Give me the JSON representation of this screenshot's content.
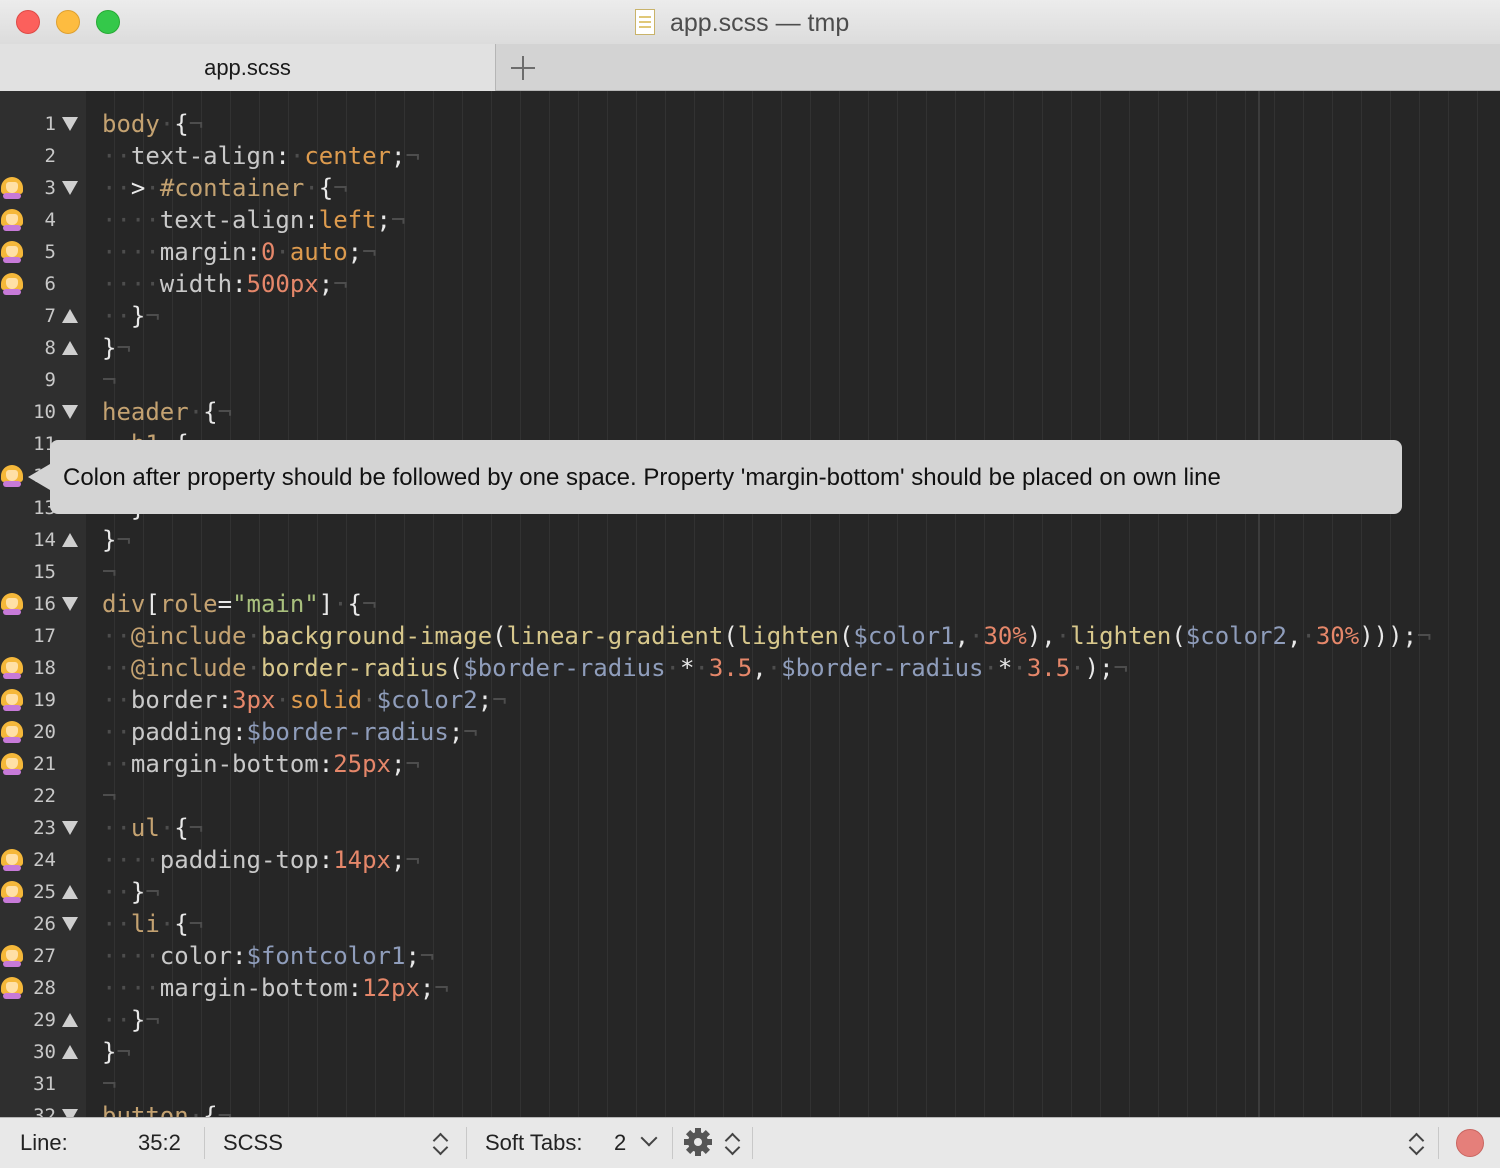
{
  "window": {
    "title": "app.scss — tmp",
    "file_icon": "document-icon"
  },
  "tabs": [
    {
      "label": "app.scss",
      "active": true
    }
  ],
  "new_tab_icon": "plus-icon",
  "editor": {
    "lines": [
      {
        "n": "1",
        "fold": "down",
        "mark": false,
        "tokens": [
          [
            "sel",
            "body"
          ],
          [
            "ws",
            "·"
          ],
          [
            "punc",
            "{"
          ],
          [
            "ws",
            "¬"
          ]
        ]
      },
      {
        "n": "2",
        "fold": "",
        "mark": false,
        "tokens": [
          [
            "ws",
            "··"
          ],
          [
            "prop",
            "text-align"
          ],
          [
            "punc",
            ":"
          ],
          [
            "ws",
            "·"
          ],
          [
            "val",
            "center"
          ],
          [
            "punc",
            ";"
          ],
          [
            "ws",
            "¬"
          ]
        ]
      },
      {
        "n": "3",
        "fold": "down",
        "mark": true,
        "tokens": [
          [
            "ws",
            "··"
          ],
          [
            "punc",
            ">"
          ],
          [
            "ws",
            "·"
          ],
          [
            "sel",
            "#container"
          ],
          [
            "ws",
            "·"
          ],
          [
            "punc",
            "{"
          ],
          [
            "ws",
            "¬"
          ]
        ]
      },
      {
        "n": "4",
        "fold": "",
        "mark": true,
        "tokens": [
          [
            "ws",
            "····"
          ],
          [
            "prop",
            "text-align"
          ],
          [
            "punc",
            ":"
          ],
          [
            "val",
            "left"
          ],
          [
            "punc",
            ";"
          ],
          [
            "ws",
            "¬"
          ]
        ]
      },
      {
        "n": "5",
        "fold": "",
        "mark": true,
        "tokens": [
          [
            "ws",
            "····"
          ],
          [
            "prop",
            "margin"
          ],
          [
            "punc",
            ":"
          ],
          [
            "num",
            "0"
          ],
          [
            "ws",
            "·"
          ],
          [
            "val",
            "auto"
          ],
          [
            "punc",
            ";"
          ],
          [
            "ws",
            "¬"
          ]
        ]
      },
      {
        "n": "6",
        "fold": "",
        "mark": true,
        "tokens": [
          [
            "ws",
            "····"
          ],
          [
            "prop",
            "width"
          ],
          [
            "punc",
            ":"
          ],
          [
            "num",
            "500px"
          ],
          [
            "punc",
            ";"
          ],
          [
            "ws",
            "¬"
          ]
        ]
      },
      {
        "n": "7",
        "fold": "up",
        "mark": false,
        "tokens": [
          [
            "ws",
            "··"
          ],
          [
            "punc",
            "}"
          ],
          [
            "ws",
            "¬"
          ]
        ]
      },
      {
        "n": "8",
        "fold": "up",
        "mark": false,
        "tokens": [
          [
            "punc",
            "}"
          ],
          [
            "ws",
            "¬"
          ]
        ]
      },
      {
        "n": "9",
        "fold": "",
        "mark": false,
        "tokens": [
          [
            "ws",
            "¬"
          ]
        ]
      },
      {
        "n": "10",
        "fold": "down",
        "mark": false,
        "tokens": [
          [
            "sel",
            "header"
          ],
          [
            "ws",
            "·"
          ],
          [
            "punc",
            "{"
          ],
          [
            "ws",
            "¬"
          ]
        ]
      },
      {
        "n": "11",
        "fold": "",
        "mark": false,
        "tokens": [
          [
            "ws",
            "··"
          ],
          [
            "sel",
            "h1"
          ],
          [
            "ws",
            "·"
          ],
          [
            "punc",
            "{"
          ],
          [
            "ws",
            "¬"
          ]
        ]
      },
      {
        "n": "12",
        "fold": "",
        "mark": false,
        "tokens": []
      },
      {
        "n": "13",
        "fold": "",
        "mark": false,
        "tokens": [
          [
            "ws",
            "··"
          ],
          [
            "punc",
            "}"
          ],
          [
            "ws",
            "¬"
          ]
        ]
      },
      {
        "n": "14",
        "fold": "up",
        "mark": false,
        "tokens": [
          [
            "punc",
            "}"
          ],
          [
            "ws",
            "¬"
          ]
        ]
      },
      {
        "n": "15",
        "fold": "",
        "mark": false,
        "tokens": [
          [
            "ws",
            "¬"
          ]
        ]
      },
      {
        "n": "16",
        "fold": "down",
        "mark": true,
        "tokens": [
          [
            "sel",
            "div"
          ],
          [
            "punc",
            "["
          ],
          [
            "sel",
            "role"
          ],
          [
            "punc",
            "="
          ],
          [
            "str",
            "\"main\""
          ],
          [
            "punc",
            "]"
          ],
          [
            "ws",
            "·"
          ],
          [
            "punc",
            "{"
          ],
          [
            "ws",
            "¬"
          ]
        ]
      },
      {
        "n": "17",
        "fold": "",
        "mark": false,
        "tokens": [
          [
            "ws",
            "··"
          ],
          [
            "at",
            "@include"
          ],
          [
            "ws",
            "·"
          ],
          [
            "func",
            "background-image"
          ],
          [
            "punc",
            "("
          ],
          [
            "func",
            "linear-gradient"
          ],
          [
            "punc",
            "("
          ],
          [
            "func",
            "lighten"
          ],
          [
            "punc",
            "("
          ],
          [
            "var",
            "$color1"
          ],
          [
            "punc",
            ","
          ],
          [
            "ws",
            "·"
          ],
          [
            "num",
            "30%"
          ],
          [
            "punc",
            "),"
          ],
          [
            "ws",
            "·"
          ],
          [
            "func",
            "lighten"
          ],
          [
            "punc",
            "("
          ],
          [
            "var",
            "$color2"
          ],
          [
            "punc",
            ","
          ],
          [
            "ws",
            "·"
          ],
          [
            "num",
            "30%"
          ],
          [
            "punc",
            ")));"
          ],
          [
            "ws",
            "¬"
          ]
        ]
      },
      {
        "n": "18",
        "fold": "",
        "mark": true,
        "tokens": [
          [
            "ws",
            "··"
          ],
          [
            "at",
            "@include"
          ],
          [
            "ws",
            "·"
          ],
          [
            "func",
            "border-radius"
          ],
          [
            "punc",
            "("
          ],
          [
            "var",
            "$border-radius"
          ],
          [
            "ws",
            "·"
          ],
          [
            "punc",
            "*"
          ],
          [
            "ws",
            "·"
          ],
          [
            "num",
            "3.5"
          ],
          [
            "punc",
            ","
          ],
          [
            "ws",
            "·"
          ],
          [
            "var",
            "$border-radius"
          ],
          [
            "ws",
            "·"
          ],
          [
            "punc",
            "*"
          ],
          [
            "ws",
            "·"
          ],
          [
            "num",
            "3.5"
          ],
          [
            "ws",
            "·"
          ],
          [
            "punc",
            ");"
          ],
          [
            "ws",
            "¬"
          ]
        ]
      },
      {
        "n": "19",
        "fold": "",
        "mark": true,
        "tokens": [
          [
            "ws",
            "··"
          ],
          [
            "prop",
            "border"
          ],
          [
            "punc",
            ":"
          ],
          [
            "num",
            "3px"
          ],
          [
            "ws",
            "·"
          ],
          [
            "val",
            "solid"
          ],
          [
            "ws",
            "·"
          ],
          [
            "var",
            "$color2"
          ],
          [
            "punc",
            ";"
          ],
          [
            "ws",
            "¬"
          ]
        ]
      },
      {
        "n": "20",
        "fold": "",
        "mark": true,
        "tokens": [
          [
            "ws",
            "··"
          ],
          [
            "prop",
            "padding"
          ],
          [
            "punc",
            ":"
          ],
          [
            "var",
            "$border-radius"
          ],
          [
            "punc",
            ";"
          ],
          [
            "ws",
            "¬"
          ]
        ]
      },
      {
        "n": "21",
        "fold": "",
        "mark": true,
        "tokens": [
          [
            "ws",
            "··"
          ],
          [
            "prop",
            "margin-bottom"
          ],
          [
            "punc",
            ":"
          ],
          [
            "num",
            "25px"
          ],
          [
            "punc",
            ";"
          ],
          [
            "ws",
            "¬"
          ]
        ]
      },
      {
        "n": "22",
        "fold": "",
        "mark": false,
        "tokens": [
          [
            "ws",
            "¬"
          ]
        ]
      },
      {
        "n": "23",
        "fold": "down",
        "mark": false,
        "tokens": [
          [
            "ws",
            "··"
          ],
          [
            "sel",
            "ul"
          ],
          [
            "ws",
            "·"
          ],
          [
            "punc",
            "{"
          ],
          [
            "ws",
            "¬"
          ]
        ]
      },
      {
        "n": "24",
        "fold": "",
        "mark": true,
        "tokens": [
          [
            "ws",
            "····"
          ],
          [
            "prop",
            "padding-top"
          ],
          [
            "punc",
            ":"
          ],
          [
            "num",
            "14px"
          ],
          [
            "punc",
            ";"
          ],
          [
            "ws",
            "¬"
          ]
        ]
      },
      {
        "n": "25",
        "fold": "up",
        "mark": true,
        "tokens": [
          [
            "ws",
            "··"
          ],
          [
            "punc",
            "}"
          ],
          [
            "ws",
            "¬"
          ]
        ]
      },
      {
        "n": "26",
        "fold": "down",
        "mark": false,
        "tokens": [
          [
            "ws",
            "··"
          ],
          [
            "sel",
            "li"
          ],
          [
            "ws",
            "·"
          ],
          [
            "punc",
            "{"
          ],
          [
            "ws",
            "¬"
          ]
        ]
      },
      {
        "n": "27",
        "fold": "",
        "mark": true,
        "tokens": [
          [
            "ws",
            "····"
          ],
          [
            "prop",
            "color"
          ],
          [
            "punc",
            ":"
          ],
          [
            "var",
            "$fontcolor1"
          ],
          [
            "punc",
            ";"
          ],
          [
            "ws",
            "¬"
          ]
        ]
      },
      {
        "n": "28",
        "fold": "",
        "mark": true,
        "tokens": [
          [
            "ws",
            "····"
          ],
          [
            "prop",
            "margin-bottom"
          ],
          [
            "punc",
            ":"
          ],
          [
            "num",
            "12px"
          ],
          [
            "punc",
            ";"
          ],
          [
            "ws",
            "¬"
          ]
        ]
      },
      {
        "n": "29",
        "fold": "up",
        "mark": false,
        "tokens": [
          [
            "ws",
            "··"
          ],
          [
            "punc",
            "}"
          ],
          [
            "ws",
            "¬"
          ]
        ]
      },
      {
        "n": "30",
        "fold": "up",
        "mark": false,
        "tokens": [
          [
            "punc",
            "}"
          ],
          [
            "ws",
            "¬"
          ]
        ]
      },
      {
        "n": "31",
        "fold": "",
        "mark": false,
        "tokens": [
          [
            "ws",
            "¬"
          ]
        ]
      },
      {
        "n": "32",
        "fold": "down",
        "mark": false,
        "tokens": [
          [
            "sel",
            "button"
          ],
          [
            "ws",
            "·"
          ],
          [
            "punc",
            "{"
          ],
          [
            "ws",
            "¬"
          ]
        ]
      }
    ]
  },
  "tooltip": {
    "text": "Colon after property should be followed by one space. Property 'margin-bottom' should be placed on own line"
  },
  "status": {
    "line_label": "Line:",
    "line_value": "35:2",
    "language": "SCSS",
    "soft_tabs_label": "Soft Tabs:",
    "soft_tabs_value": "2",
    "gear_icon": "gear-icon",
    "record_icon": "record-icon"
  },
  "colors": {
    "editor_bg": "#262626",
    "gutter_bg": "#2f2f2f",
    "tooltip_bg": "#d4d4d4",
    "selector": "#c4a271",
    "number": "#e5876a",
    "variable": "#8f9dbb",
    "string": "#a9c07d"
  }
}
